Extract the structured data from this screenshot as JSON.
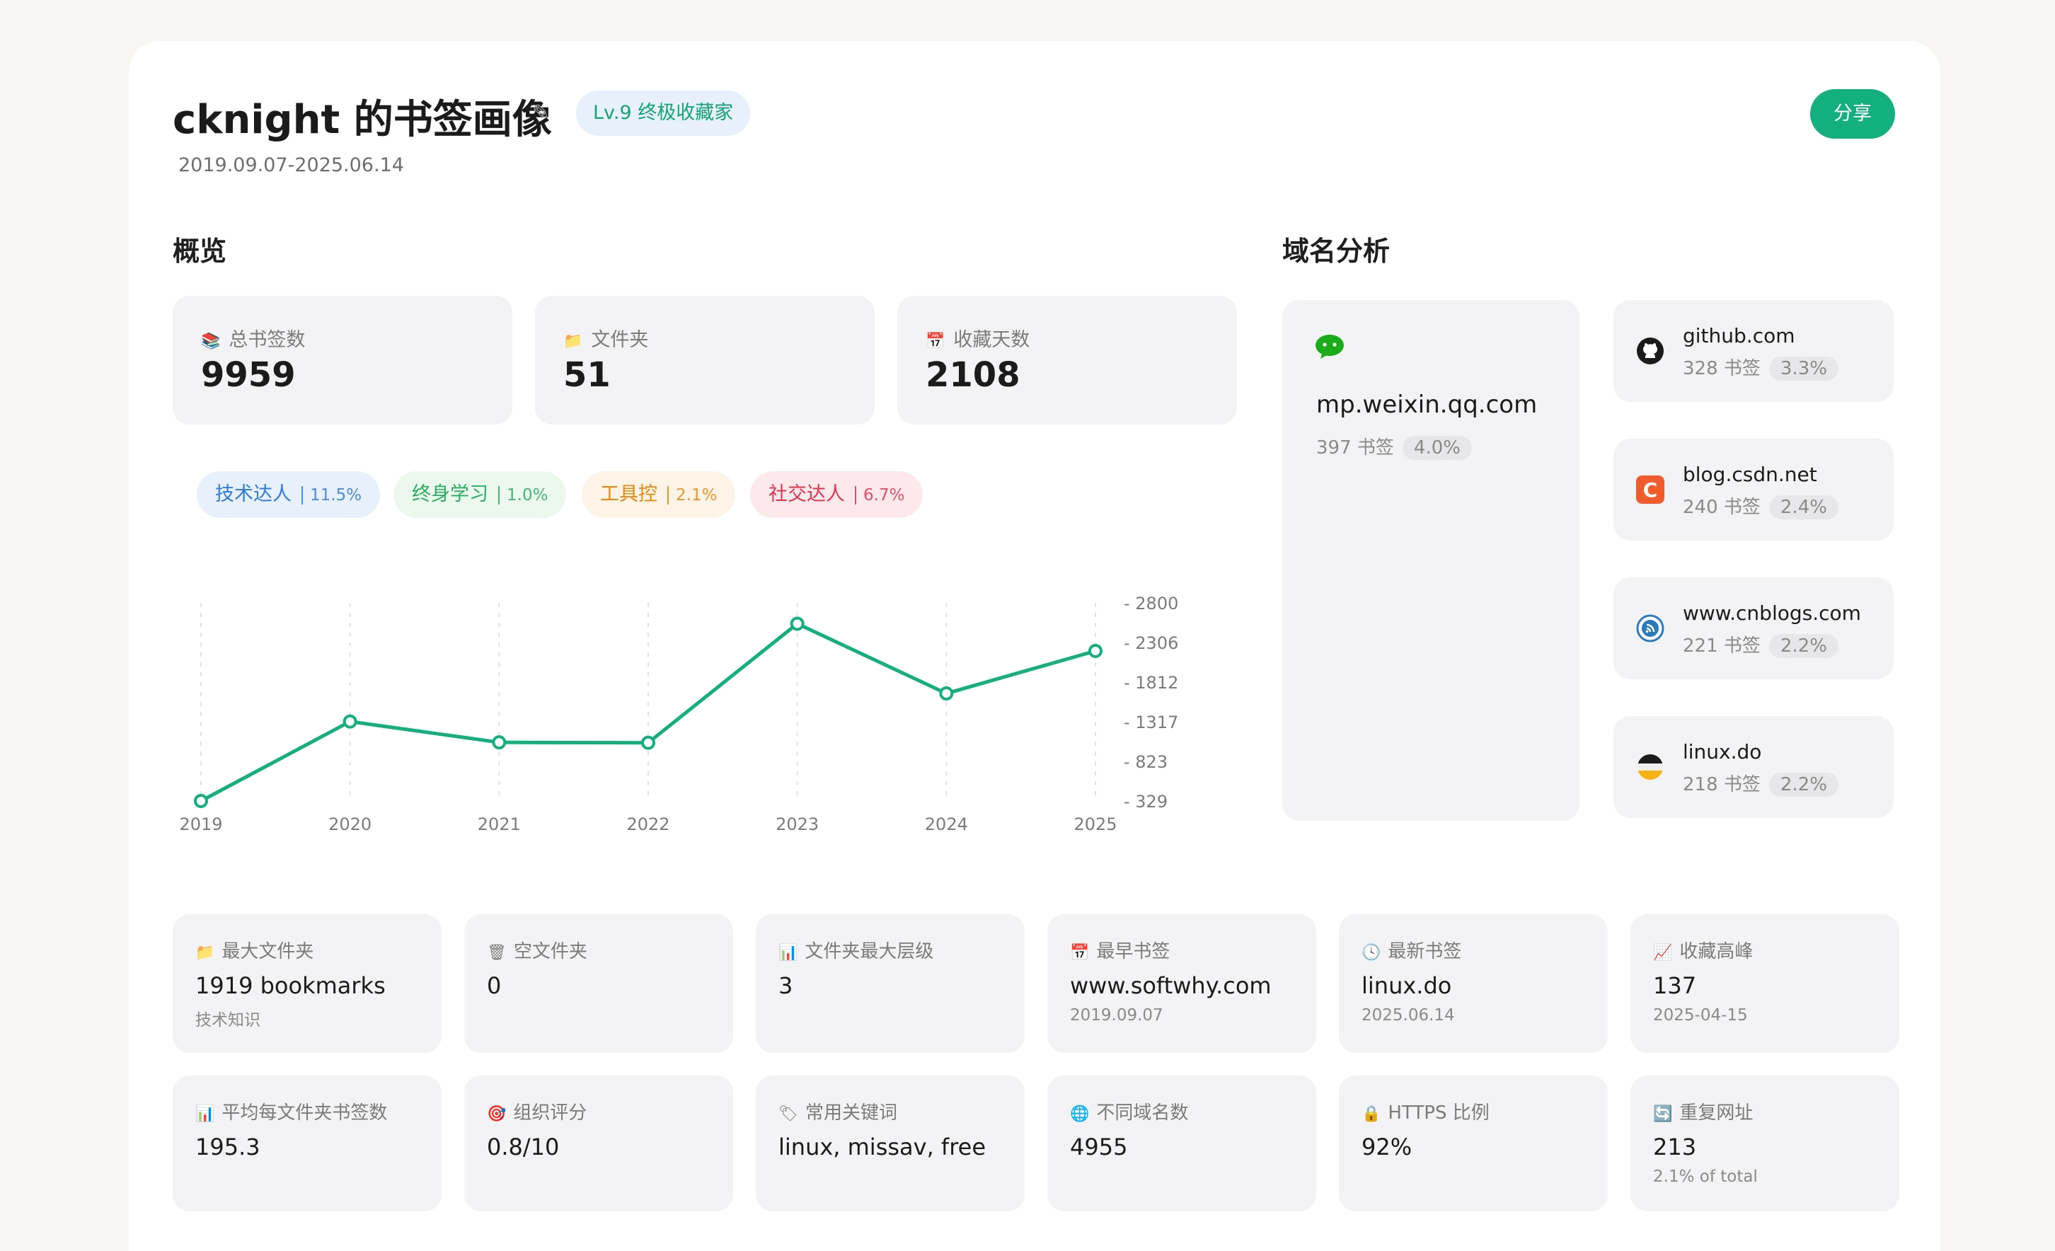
{
  "header": {
    "title": "cknight 的书签画像",
    "level_badge": "Lv.9  终极收藏家",
    "share_label": "分享",
    "date_range": "2019.09.07-2025.06.14"
  },
  "overview": {
    "section_title": "概览",
    "stats": [
      {
        "icon": "books-icon",
        "label": "总书签数",
        "value": "9959"
      },
      {
        "icon": "folder-icon",
        "label": "文件夹",
        "value": "51"
      },
      {
        "icon": "calendar-icon",
        "label": "收藏天数",
        "value": "2108"
      }
    ],
    "tags": [
      {
        "label": "技术达人",
        "pct": "11.5%",
        "color": "#2f7be0",
        "bg": "#e8f1fb"
      },
      {
        "label": "终身学习",
        "pct": "1.0%",
        "color": "#27ae60",
        "bg": "#ecf7ee"
      },
      {
        "label": "工具控",
        "pct": "2.1%",
        "color": "#e8890c",
        "bg": "#fdf3e7"
      },
      {
        "label": "社交达人",
        "pct": "6.7%",
        "color": "#e0344f",
        "bg": "#fde9ec"
      }
    ]
  },
  "chart_data": {
    "type": "line",
    "x": [
      "2019",
      "2020",
      "2021",
      "2022",
      "2023",
      "2024",
      "2025"
    ],
    "series": [
      {
        "values": [
          329,
          1320,
          1060,
          1055,
          2540,
          1670,
          2200
        ]
      }
    ],
    "y_ticks": [
      "2800",
      "2306",
      "1812",
      "1317",
      "823",
      "329"
    ],
    "ylim": [
      329,
      2800
    ],
    "grid": "vertical-dashed",
    "line_color": "#13b07d"
  },
  "domains": {
    "section_title": "域名分析",
    "top": {
      "name": "mp.weixin.qq.com",
      "count": "397 书签",
      "pct": "4.0%",
      "icon": "wechat-icon"
    },
    "others": [
      {
        "name": "github.com",
        "count": "328 书签",
        "pct": "3.3%",
        "icon": "github-icon"
      },
      {
        "name": "blog.csdn.net",
        "count": "240 书签",
        "pct": "2.4%",
        "icon": "csdn-icon"
      },
      {
        "name": "www.cnblogs.com",
        "count": "221 书签",
        "pct": "2.2%",
        "icon": "cnblogs-icon"
      },
      {
        "name": "linux.do",
        "count": "218 书签",
        "pct": "2.2%",
        "icon": "linuxdo-icon"
      }
    ]
  },
  "details": [
    {
      "icon": "folder-icon",
      "label": "最大文件夹",
      "value": "1919 bookmarks",
      "sub": "技术知识"
    },
    {
      "icon": "trash-icon",
      "label": "空文件夹",
      "value": "0",
      "sub": ""
    },
    {
      "icon": "bar-chart-icon",
      "label": "文件夹最大层级",
      "value": "3",
      "sub": ""
    },
    {
      "icon": "calendar-icon",
      "label": "最早书签",
      "value": "www.softwhy.com",
      "sub": "2019.09.07"
    },
    {
      "icon": "clock-icon",
      "label": "最新书签",
      "value": "linux.do",
      "sub": "2025.06.14"
    },
    {
      "icon": "trend-icon",
      "label": "收藏高峰",
      "value": "137",
      "sub": "2025-04-15"
    },
    {
      "icon": "bar-chart-icon",
      "label": "平均每文件夹书签数",
      "value": "195.3",
      "sub": ""
    },
    {
      "icon": "target-icon",
      "label": "组织评分",
      "value": "0.8/10",
      "sub": ""
    },
    {
      "icon": "tag-icon",
      "label": "常用关键词",
      "value": "linux, missav, free",
      "sub": ""
    },
    {
      "icon": "globe-icon",
      "label": "不同域名数",
      "value": "4955",
      "sub": ""
    },
    {
      "icon": "lock-icon",
      "label": "HTTPS 比例",
      "value": "92%",
      "sub": ""
    },
    {
      "icon": "repeat-icon",
      "label": "重复网址",
      "value": "213",
      "sub": "2.1% of total"
    }
  ]
}
